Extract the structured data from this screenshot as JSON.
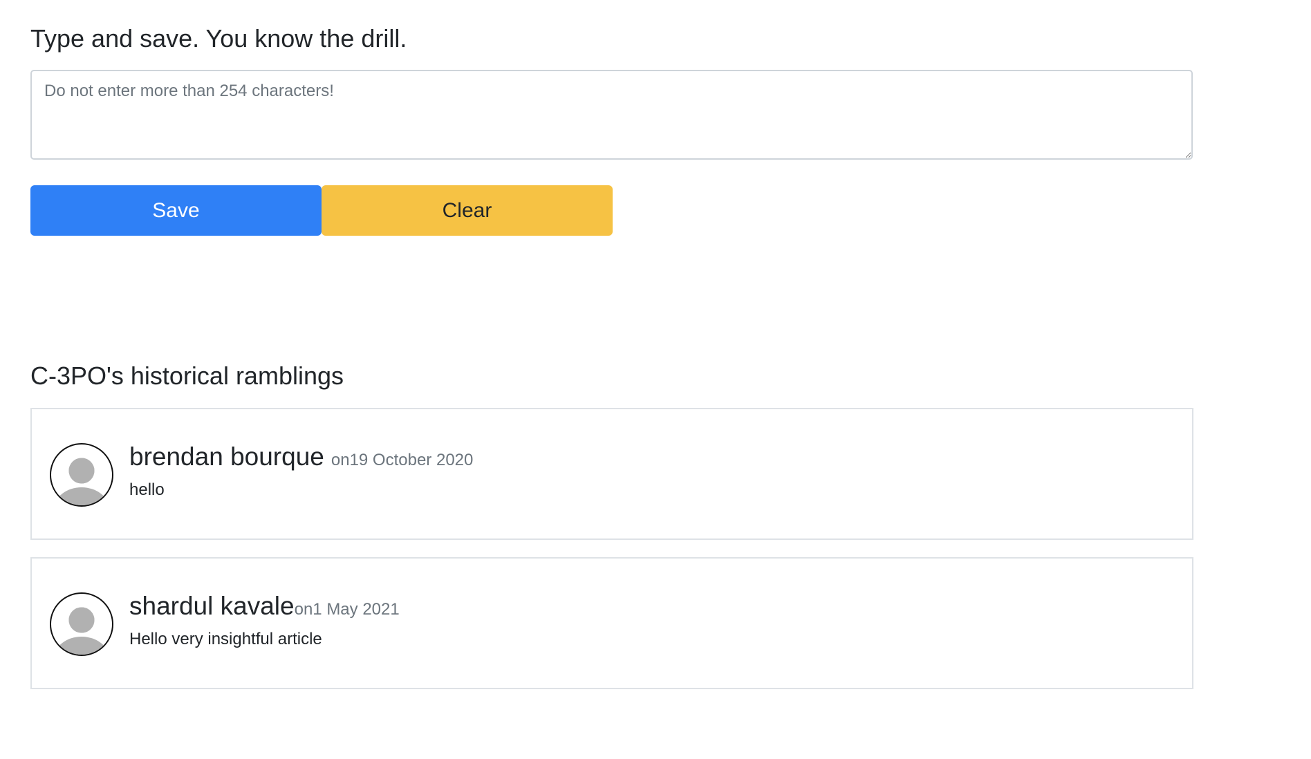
{
  "composer": {
    "heading": "Type and save. You know the drill.",
    "textarea_value": "",
    "textarea_placeholder": "Do not enter more than 254 characters!",
    "save_label": "Save",
    "clear_label": "Clear"
  },
  "history": {
    "heading": "C-3PO's historical ramblings",
    "comments": [
      {
        "author": "brendan bourque",
        "date_prefix": "on",
        "date": "19 October 2020",
        "text": "hello",
        "avatar_icon": "user-placeholder-icon"
      },
      {
        "author": "shardul kavale",
        "date_prefix": "on",
        "date": "1 May 2021",
        "text": "Hello very insightful article",
        "avatar_icon": "user-placeholder-icon"
      }
    ]
  },
  "colors": {
    "save_button": "#2f80f6",
    "clear_button": "#f6c244",
    "muted_text": "#6c757d",
    "border": "#dee2e6"
  }
}
